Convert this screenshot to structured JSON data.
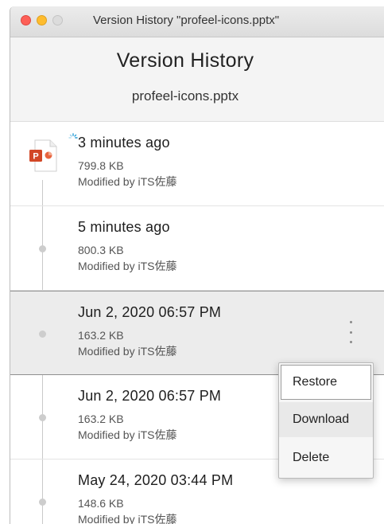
{
  "window": {
    "title": "Version History \"profeel-icons.pptx\""
  },
  "header": {
    "title": "Version History",
    "filename": "profeel-icons.pptx"
  },
  "versions": [
    {
      "time": "3 minutes ago",
      "size": "799.8 KB",
      "modified": "Modified by iTS佐藤"
    },
    {
      "time": "5 minutes ago",
      "size": "800.3 KB",
      "modified": "Modified by iTS佐藤"
    },
    {
      "time": "Jun  2, 2020 06:57 PM",
      "size": "163.2 KB",
      "modified": "Modified by iTS佐藤"
    },
    {
      "time": "Jun  2, 2020 06:57 PM",
      "size": "163.2 KB",
      "modified": "Modified by iTS佐藤"
    },
    {
      "time": "May 24, 2020 03:44 PM",
      "size": "148.6 KB",
      "modified": "Modified by iTS佐藤"
    }
  ],
  "context_menu": {
    "items": [
      "Restore",
      "Download",
      "Delete"
    ]
  },
  "colors": {
    "powerpoint_orange": "#d24726",
    "spinner_blue": "#2a9fd8",
    "close": "#fd5f57",
    "minimize": "#febc2e"
  },
  "icons": {
    "file": "powerpoint-file-icon",
    "loading": "loading-spinner-icon",
    "more": "more-vertical-icon"
  }
}
